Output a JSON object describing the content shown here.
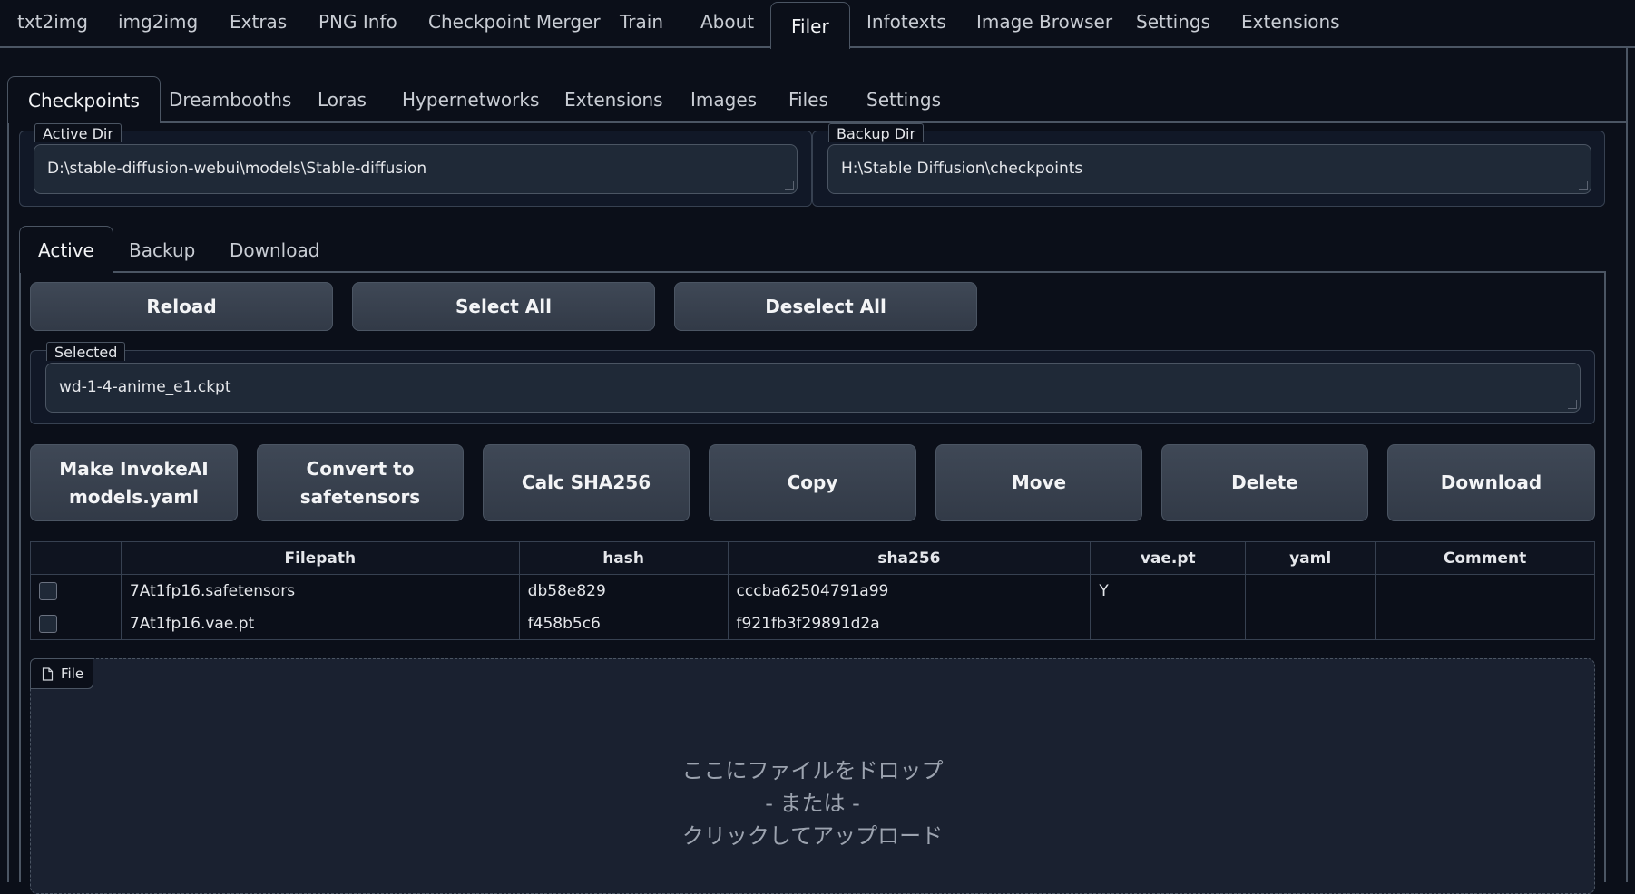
{
  "top_tabs": [
    "txt2img",
    "img2img",
    "Extras",
    "PNG Info",
    "Checkpoint Merger",
    "Train",
    "About",
    "Filer",
    "Infotexts",
    "Image Browser",
    "Settings",
    "Extensions"
  ],
  "sub_tabs": [
    "Checkpoints",
    "Dreambooths",
    "Loras",
    "Hypernetworks",
    "Extensions",
    "Images",
    "Files",
    "Settings"
  ],
  "active_dir": {
    "label": "Active Dir",
    "value": "D:\\stable-diffusion-webui\\models\\Stable-diffusion"
  },
  "backup_dir": {
    "label": "Backup Dir",
    "value": "H:\\Stable Diffusion\\checkpoints"
  },
  "inner_tabs": [
    "Active",
    "Backup",
    "Download"
  ],
  "buttons_row1": [
    "Reload",
    "Select All",
    "Deselect All"
  ],
  "selected": {
    "label": "Selected",
    "value": "wd-1-4-anime_e1.ckpt"
  },
  "buttons_row2": {
    "make_invokeai": [
      "Make InvokeAI",
      "models.yaml"
    ],
    "convert": [
      "Convert to",
      "safetensors"
    ],
    "calc_sha": "Calc SHA256",
    "copy": "Copy",
    "move": "Move",
    "delete": "Delete",
    "download": "Download"
  },
  "table": {
    "headers": [
      "",
      "Filepath",
      "hash",
      "sha256",
      "vae.pt",
      "yaml",
      "Comment"
    ],
    "rows": [
      {
        "filepath": "7At1fp16.safetensors",
        "hash": "db58e829",
        "sha256": "cccba62504791a99",
        "vae": "Y",
        "yaml": "",
        "comment": ""
      },
      {
        "filepath": "7At1fp16.vae.pt",
        "hash": "f458b5c6",
        "sha256": "f921fb3f29891d2a",
        "vae": "",
        "yaml": "",
        "comment": ""
      }
    ]
  },
  "upload": {
    "badge": "File",
    "line1": "ここにファイルをドロップ",
    "line2": "- または -",
    "line3": "クリックしてアップロード"
  },
  "colors": {
    "background": "#0b0f19",
    "panel": "#111827",
    "button": "#374151",
    "border": "#4b5563"
  }
}
